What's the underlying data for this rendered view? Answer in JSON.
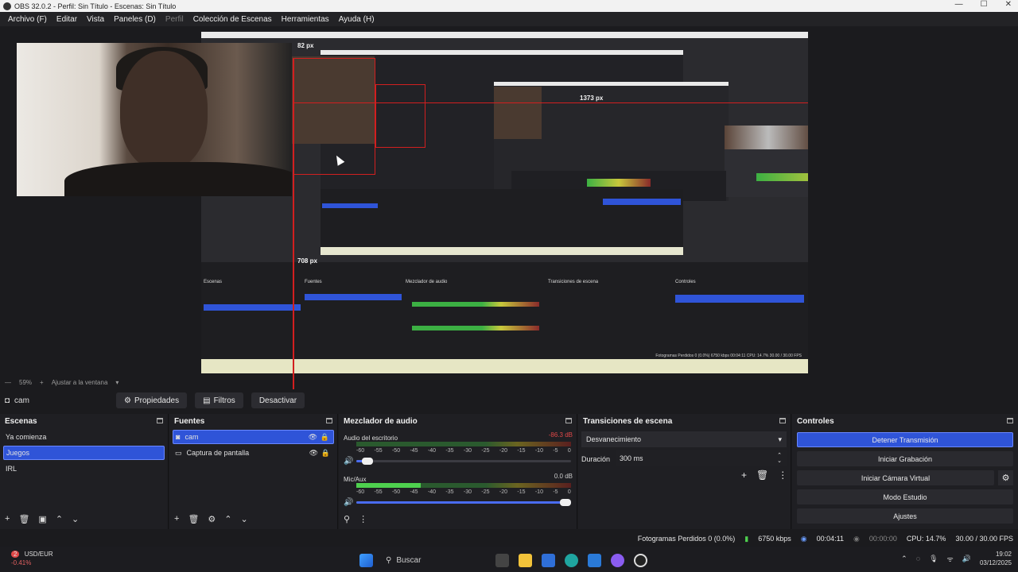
{
  "window": {
    "title": "OBS 32.0.2 - Perfil: Sin Título - Escenas: Sin Título",
    "minimize": "—",
    "maximize": "☐",
    "close": "✕"
  },
  "menu": {
    "items": [
      "Archivo (F)",
      "Editar",
      "Vista",
      "Paneles (D)",
      "Perfil",
      "Colección de Escenas",
      "Herramientas",
      "Ayuda (H)"
    ]
  },
  "preview": {
    "measure_top": "82 px",
    "measure_right": "1373 px",
    "measure_bottom": "708 px",
    "mini_status": "Fotogramas Perdidos 0 (0.0%)   6750 kbps   00:04:11   CPU: 14.7%   30.00 / 30.00 FPS",
    "mini_docks": {
      "sources": "Fuentes",
      "scenes": "Escenas",
      "mixer": "Mezclador de audio",
      "transitions": "Transiciones de escena",
      "controls": "Controles"
    }
  },
  "zoom": {
    "level": "59%",
    "fit": "Ajustar a la ventana"
  },
  "source_toolbar": {
    "source_name": "cam",
    "properties": "Propiedades",
    "filters": "Filtros",
    "deactivate": "Desactivar"
  },
  "scenes": {
    "title": "Escenas",
    "items": [
      "Ya comienza",
      "Juegos",
      "IRL"
    ],
    "selected_index": 1
  },
  "sources": {
    "title": "Fuentes",
    "items": [
      {
        "name": "cam",
        "icon": "camera-icon"
      },
      {
        "name": "Captura de pantalla",
        "icon": "monitor-icon"
      }
    ]
  },
  "mixer": {
    "title": "Mezclador de audio",
    "channels": [
      {
        "name": "Audio del escritorio",
        "db": "-86.3 dB",
        "level": 0.0,
        "volume": 0.05
      },
      {
        "name": "Mic/Aux",
        "db": "0.0 dB",
        "level": 0.3,
        "volume": 1.0
      }
    ],
    "scale": [
      "-60",
      "-55",
      "-50",
      "-45",
      "-40",
      "-35",
      "-30",
      "-25",
      "-20",
      "-15",
      "-10",
      "-5",
      "0"
    ]
  },
  "transitions": {
    "title": "Transiciones de escena",
    "selected": "Desvanecimiento",
    "duration_label": "Duración",
    "duration_value": "300 ms"
  },
  "controls": {
    "title": "Controles",
    "buttons": [
      "Detener Transmisión",
      "Iniciar Grabación",
      "Iniciar Cámara Virtual",
      "Modo Estudio",
      "Ajustes"
    ]
  },
  "status": {
    "dropped": "Fotogramas Perdidos 0 (0.0%)",
    "bitrate": "6750 kbps",
    "stream_time": "00:04:11",
    "rec_time": "00:00:00",
    "cpu": "CPU: 14.7%",
    "fps": "30.00 / 30.00 FPS"
  },
  "taskbar": {
    "ticker": "USD/EUR",
    "ticker_change": "-0.41%",
    "ticker_badge": "2",
    "search": "Buscar",
    "time": "19:02",
    "date": "03/12/2025"
  },
  "colors": {
    "accent": "#2f54d8",
    "measure_red": "#d21f1f",
    "meter_green": "#4ed04e"
  }
}
